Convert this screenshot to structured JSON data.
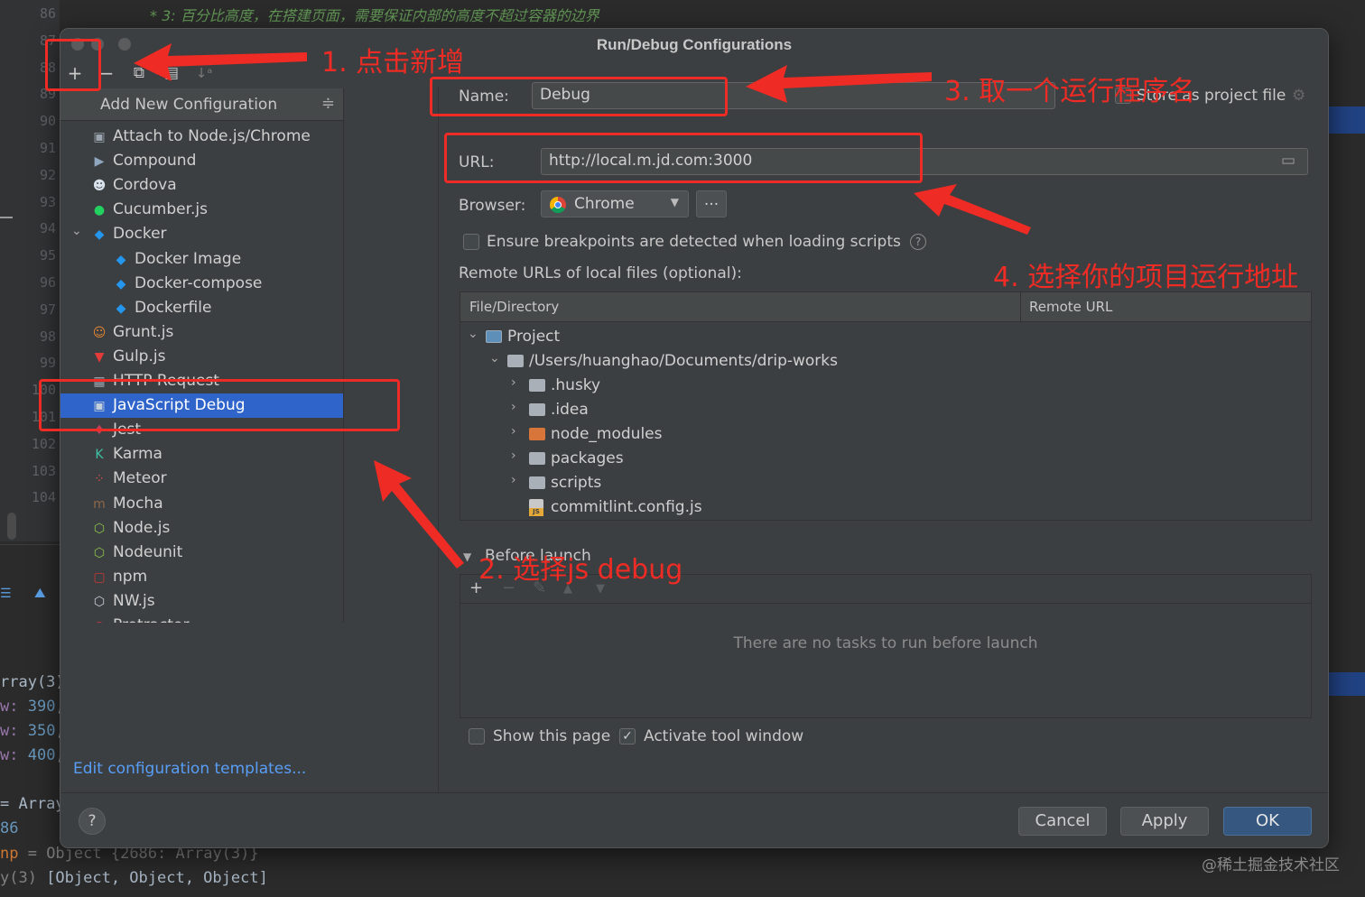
{
  "editor": {
    "line_numbers": [
      "86",
      "87",
      "88",
      "89",
      "90",
      "91",
      "92",
      "93",
      "94",
      "95",
      "96",
      "97",
      "98",
      "99",
      "100",
      "101",
      "102",
      "103",
      "104"
    ],
    "comment_line": "* 3: 百分比高度，在搭建页面，需要保证内部的高度不超过容器的边界"
  },
  "debug_panel": {
    "lines": [
      {
        "a": "rray(3) |",
        "b": "",
        "c": ""
      },
      {
        "a": "w: ",
        "b": "390",
        "c": ","
      },
      {
        "a": "w: ",
        "b": "350",
        "c": ", |"
      },
      {
        "a": "w: ",
        "b": "400",
        "c": ","
      },
      {
        "a": "= Array",
        "b": "",
        "c": ""
      },
      {
        "a": "",
        "b": "86",
        "c": ""
      }
    ],
    "object_line": {
      "key": "np",
      "eq": " = Object {",
      "num": "2686",
      "rest": ": Array(3)}"
    },
    "array_line": {
      "key": "y(3) ",
      "rest": "[Object, Object, Object]"
    }
  },
  "dialog": {
    "title": "Run/Debug Configurations",
    "toolbar": {
      "add": "+",
      "remove": "−",
      "copy": "⧉",
      "folder": "▤",
      "sort": "↓ᵃ"
    },
    "popup": {
      "title": "Add New Configuration",
      "items": [
        {
          "label": "Attach to Node.js/Chrome",
          "icon": "▣",
          "color": "#9ba5b0",
          "indent": 0
        },
        {
          "label": "Compound",
          "icon": "▶",
          "color": "#8fa6bf",
          "indent": 0
        },
        {
          "label": "Cordova",
          "icon": "☻",
          "color": "#d8e3ee",
          "indent": 0
        },
        {
          "label": "Cucumber.js",
          "icon": "●",
          "color": "#23d160",
          "indent": 0
        },
        {
          "label": "Docker",
          "icon": "◆",
          "color": "#2496ed",
          "indent": 0,
          "expanded": true
        },
        {
          "label": "Docker Image",
          "icon": "◆",
          "color": "#2496ed",
          "indent": 1
        },
        {
          "label": "Docker-compose",
          "icon": "◆",
          "color": "#2496ed",
          "indent": 1
        },
        {
          "label": "Dockerfile",
          "icon": "◆",
          "color": "#2496ed",
          "indent": 1
        },
        {
          "label": "Grunt.js",
          "icon": "☺",
          "color": "#e48632",
          "indent": 0
        },
        {
          "label": "Gulp.js",
          "icon": "▼",
          "color": "#e53a3a",
          "indent": 0
        },
        {
          "label": "HTTP Request",
          "icon": "▦",
          "color": "#a0aab4",
          "indent": 0
        },
        {
          "label": "JavaScript Debug",
          "icon": "▣",
          "color": "#c3cfda",
          "indent": 0,
          "selected": true
        },
        {
          "label": "Jest",
          "icon": "♦",
          "color": "#c63d5a",
          "indent": 0
        },
        {
          "label": "Karma",
          "icon": "K",
          "color": "#3ec1a5",
          "indent": 0
        },
        {
          "label": "Meteor",
          "icon": "⁘",
          "color": "#d9534f",
          "indent": 0
        },
        {
          "label": "Mocha",
          "icon": "m",
          "color": "#8d6748",
          "indent": 0
        },
        {
          "label": "Node.js",
          "icon": "⬡",
          "color": "#8bc34a",
          "indent": 0
        },
        {
          "label": "Nodeunit",
          "icon": "⬡",
          "color": "#8bc34a",
          "indent": 0
        },
        {
          "label": "npm",
          "icon": "▢",
          "color": "#cb3837",
          "indent": 0
        },
        {
          "label": "NW.js",
          "icon": "⬡",
          "color": "#c8d2dc",
          "indent": 0
        },
        {
          "label": "Protractor",
          "icon": "◉",
          "color": "#e23237",
          "indent": 0
        }
      ]
    },
    "edit_templates": "Edit configuration templates...",
    "name_label": "Name:",
    "name_value": "Debug",
    "store_label": "Store as project file",
    "url_label": "URL:",
    "url_value": "http://local.m.jd.com:3000",
    "browser_label": "Browser:",
    "browser_value": "Chrome",
    "browser_more": "...",
    "ensure_label": "Ensure breakpoints are detected when loading scripts",
    "remote_urls_label": "Remote URLs of local files (optional):",
    "table": {
      "columns": [
        "File/Directory",
        "Remote URL"
      ],
      "rows": [
        {
          "label": "Project",
          "kind": "project",
          "level": 0,
          "arrow": "⌄"
        },
        {
          "label": "/Users/huanghao/Documents/drip-works",
          "kind": "folder",
          "level": 1,
          "arrow": "⌄"
        },
        {
          "label": ".husky",
          "kind": "folder",
          "level": 2,
          "arrow": "›"
        },
        {
          "label": ".idea",
          "kind": "folder",
          "level": 2,
          "arrow": "›"
        },
        {
          "label": "node_modules",
          "kind": "orange",
          "level": 2,
          "arrow": "›"
        },
        {
          "label": "packages",
          "kind": "folder",
          "level": 2,
          "arrow": "›"
        },
        {
          "label": "scripts",
          "kind": "folder",
          "level": 2,
          "arrow": "›"
        },
        {
          "label": "commitlint.config.js",
          "kind": "js",
          "level": 2,
          "arrow": ""
        }
      ]
    },
    "before_launch": "Before launch",
    "bl_tools": [
      "+",
      "−",
      "✎",
      "▲",
      "▼"
    ],
    "bl_empty": "There are no tasks to run before launch",
    "show_page_label": "Show this page",
    "activate_label": "Activate tool window",
    "activate_check": "✓",
    "help": "?",
    "buttons": {
      "cancel": "Cancel",
      "apply": "Apply",
      "ok": "OK"
    }
  },
  "annotations": {
    "step1": "1. 点击新增",
    "step2": "2. 选择js debug",
    "step3": "3. 取一个运行程序名",
    "step4": "4. 选择你的项目运行地址"
  },
  "watermark": "@稀土掘金技术社区",
  "colors": {
    "accent_selection": "#2f65ca",
    "annotation_red": "#ee2b24",
    "primary_button": "#365880",
    "link": "#589df6"
  }
}
